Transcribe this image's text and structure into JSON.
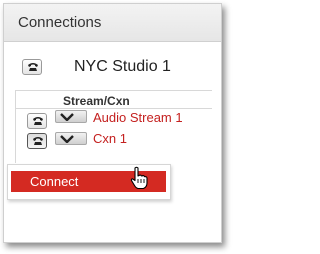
{
  "panel": {
    "title": "Connections",
    "studio_name": "NYC Studio 1"
  },
  "table": {
    "column_header": "Stream/Cxn",
    "rows": [
      {
        "label": "Audio Stream 1"
      },
      {
        "label": "Cxn 1"
      }
    ]
  },
  "context_menu": {
    "items": [
      {
        "label": "Connect"
      }
    ]
  },
  "colors": {
    "accent_red": "#d42a22",
    "link_red": "#c4201f"
  }
}
